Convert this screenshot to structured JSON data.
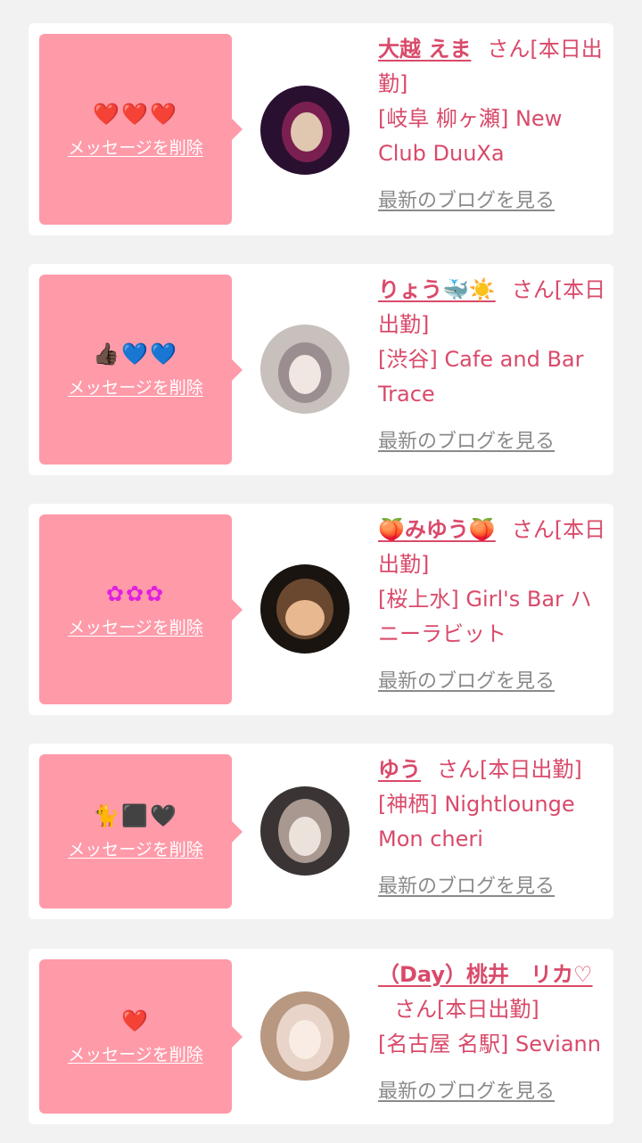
{
  "messages": [
    {
      "reaction": "❤️❤️❤️",
      "delete_label": "メッセージを削除",
      "name": "大越 えま",
      "suffix": "さん[本日出勤]",
      "shop": "[岐阜 柳ヶ瀬] New Club DuuXa",
      "blog_label": "最新のブログを見る",
      "avatar_colors": [
        "#2a1030",
        "#7a2050",
        "#e0c8b0"
      ]
    },
    {
      "reaction": "👍🏿💙💙",
      "delete_label": "メッセージを削除",
      "name": "りょう🐳☀️",
      "suffix": "さん[本日出勤]",
      "shop": "[渋谷] Cafe and Bar Trace",
      "blog_label": "最新のブログを見る",
      "avatar_colors": [
        "#c8c0bc",
        "#9a8e90",
        "#f0e6e2"
      ]
    },
    {
      "reaction": "✿✿✿",
      "delete_label": "メッセージを削除",
      "name": "🍑みゆう🍑",
      "suffix": "さん[本日出勤]",
      "shop": "[桜上水] Girl's Bar ハニーラビット",
      "blog_label": "最新のブログを見る",
      "avatar_colors": [
        "#1a1410",
        "#6a4830",
        "#e8b890"
      ]
    },
    {
      "reaction": "🐈⬛🖤",
      "delete_label": "メッセージを削除",
      "name": "ゆう",
      "suffix": "さん[本日出勤]",
      "shop": "[神栖] Nightlounge Mon cheri",
      "blog_label": "最新のブログを見る",
      "avatar_colors": [
        "#3a3434",
        "#a89890",
        "#ece2dc"
      ]
    },
    {
      "reaction": "❤️",
      "delete_label": "メッセージを削除",
      "name": "（Day）桃井　リカ♡",
      "suffix": "さん[本日出勤]",
      "shop": "[名古屋 名駅] Seviann",
      "blog_label": "最新のブログを見る",
      "avatar_colors": [
        "#b89880",
        "#e8d4c8",
        "#f8ece4"
      ]
    }
  ],
  "theme": {
    "page_bg": "#f2f2f2",
    "card_bg": "#ffffff",
    "bubble_bg": "#ff9aa9",
    "accent": "#d94a6a",
    "muted": "#8a8a8a"
  }
}
